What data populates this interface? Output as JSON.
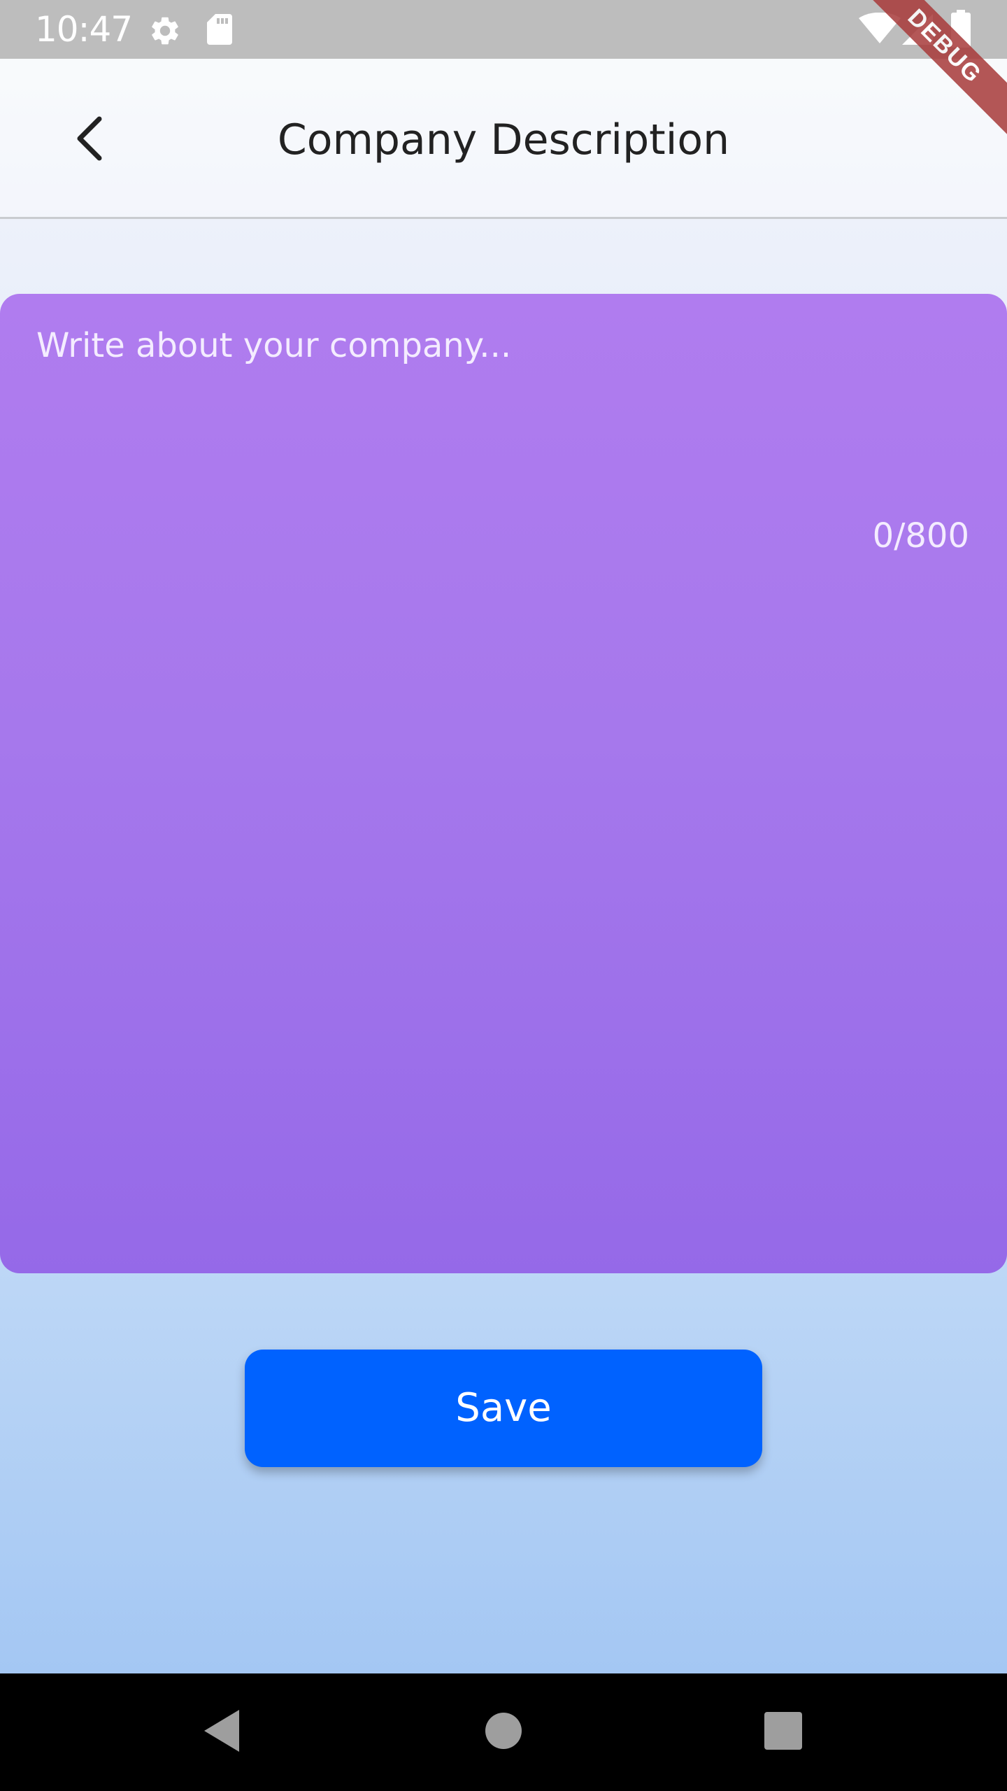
{
  "status_bar": {
    "time": "10:47",
    "icons": [
      "gear-icon",
      "sd-card-icon",
      "wifi-icon",
      "signal-icon",
      "battery-icon"
    ]
  },
  "debug_banner": "DEBUG",
  "header": {
    "title": "Company Description",
    "back_icon": "chevron-left-icon"
  },
  "description_field": {
    "placeholder": "Write about your company...",
    "value": "",
    "counter": "0/800"
  },
  "save_button": {
    "label": "Save"
  },
  "system_nav": {
    "buttons": [
      "back-triangle-icon",
      "home-circle-icon",
      "recents-square-icon"
    ]
  },
  "colors": {
    "accent_blue": "#0062ff",
    "card_purple_top": "#b07cef",
    "card_purple_bottom": "#9569e8",
    "status_bar": "#bdbdbd"
  }
}
